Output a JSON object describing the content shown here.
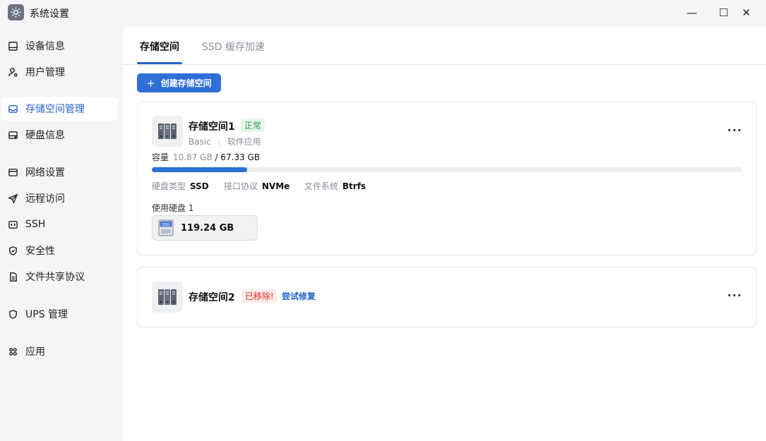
{
  "window": {
    "title": "系统设置",
    "minimize_glyph": "—",
    "maximize_glyph": "☐",
    "close_glyph": "✕"
  },
  "sidebar": {
    "items": [
      {
        "label": "设备信息",
        "icon": "device-icon"
      },
      {
        "label": "用户管理",
        "icon": "user-icon"
      },
      {
        "label": "存储空间管理",
        "icon": "storage-icon",
        "active": true
      },
      {
        "label": "硬盘信息",
        "icon": "disk-icon"
      },
      {
        "label": "网络设置",
        "icon": "network-icon"
      },
      {
        "label": "远程访问",
        "icon": "send-icon"
      },
      {
        "label": "SSH",
        "icon": "code-icon"
      },
      {
        "label": "安全性",
        "icon": "shield-icon"
      },
      {
        "label": "文件共享协议",
        "icon": "file-icon"
      },
      {
        "label": "UPS 管理",
        "icon": "ups-shield-icon"
      },
      {
        "label": "应用",
        "icon": "apps-icon"
      }
    ]
  },
  "tabs": [
    {
      "label": "存储空间",
      "active": true
    },
    {
      "label": "SSD 缓存加速",
      "active": false
    }
  ],
  "create_button": {
    "plus": "+",
    "label": "创建存储空间"
  },
  "pools": [
    {
      "name": "存储空间1",
      "status": "正常",
      "type": "Basic",
      "source": "软件应用",
      "capacity_label": "容量",
      "used": "10.87 GB",
      "total": "/ 67.33 GB",
      "used_fraction": 0.1615,
      "disk_type_label": "硬盘类型",
      "disk_type": "SSD",
      "interface_label": "接口协议",
      "interface": "NVMe",
      "fs_label": "文件系统",
      "fs": "Btrfs",
      "disks_label": "使用硬盘 1",
      "disk_size": "119.24 GB",
      "disk_icon_text": "SSD",
      "more": "···"
    },
    {
      "name": "存储空间2",
      "status": "已移除!",
      "repair": "尝试修复",
      "more": "···"
    }
  ],
  "colors": {
    "accent": "#2f6fd8",
    "ok": "#2e9b4a",
    "error": "#d92d20"
  }
}
